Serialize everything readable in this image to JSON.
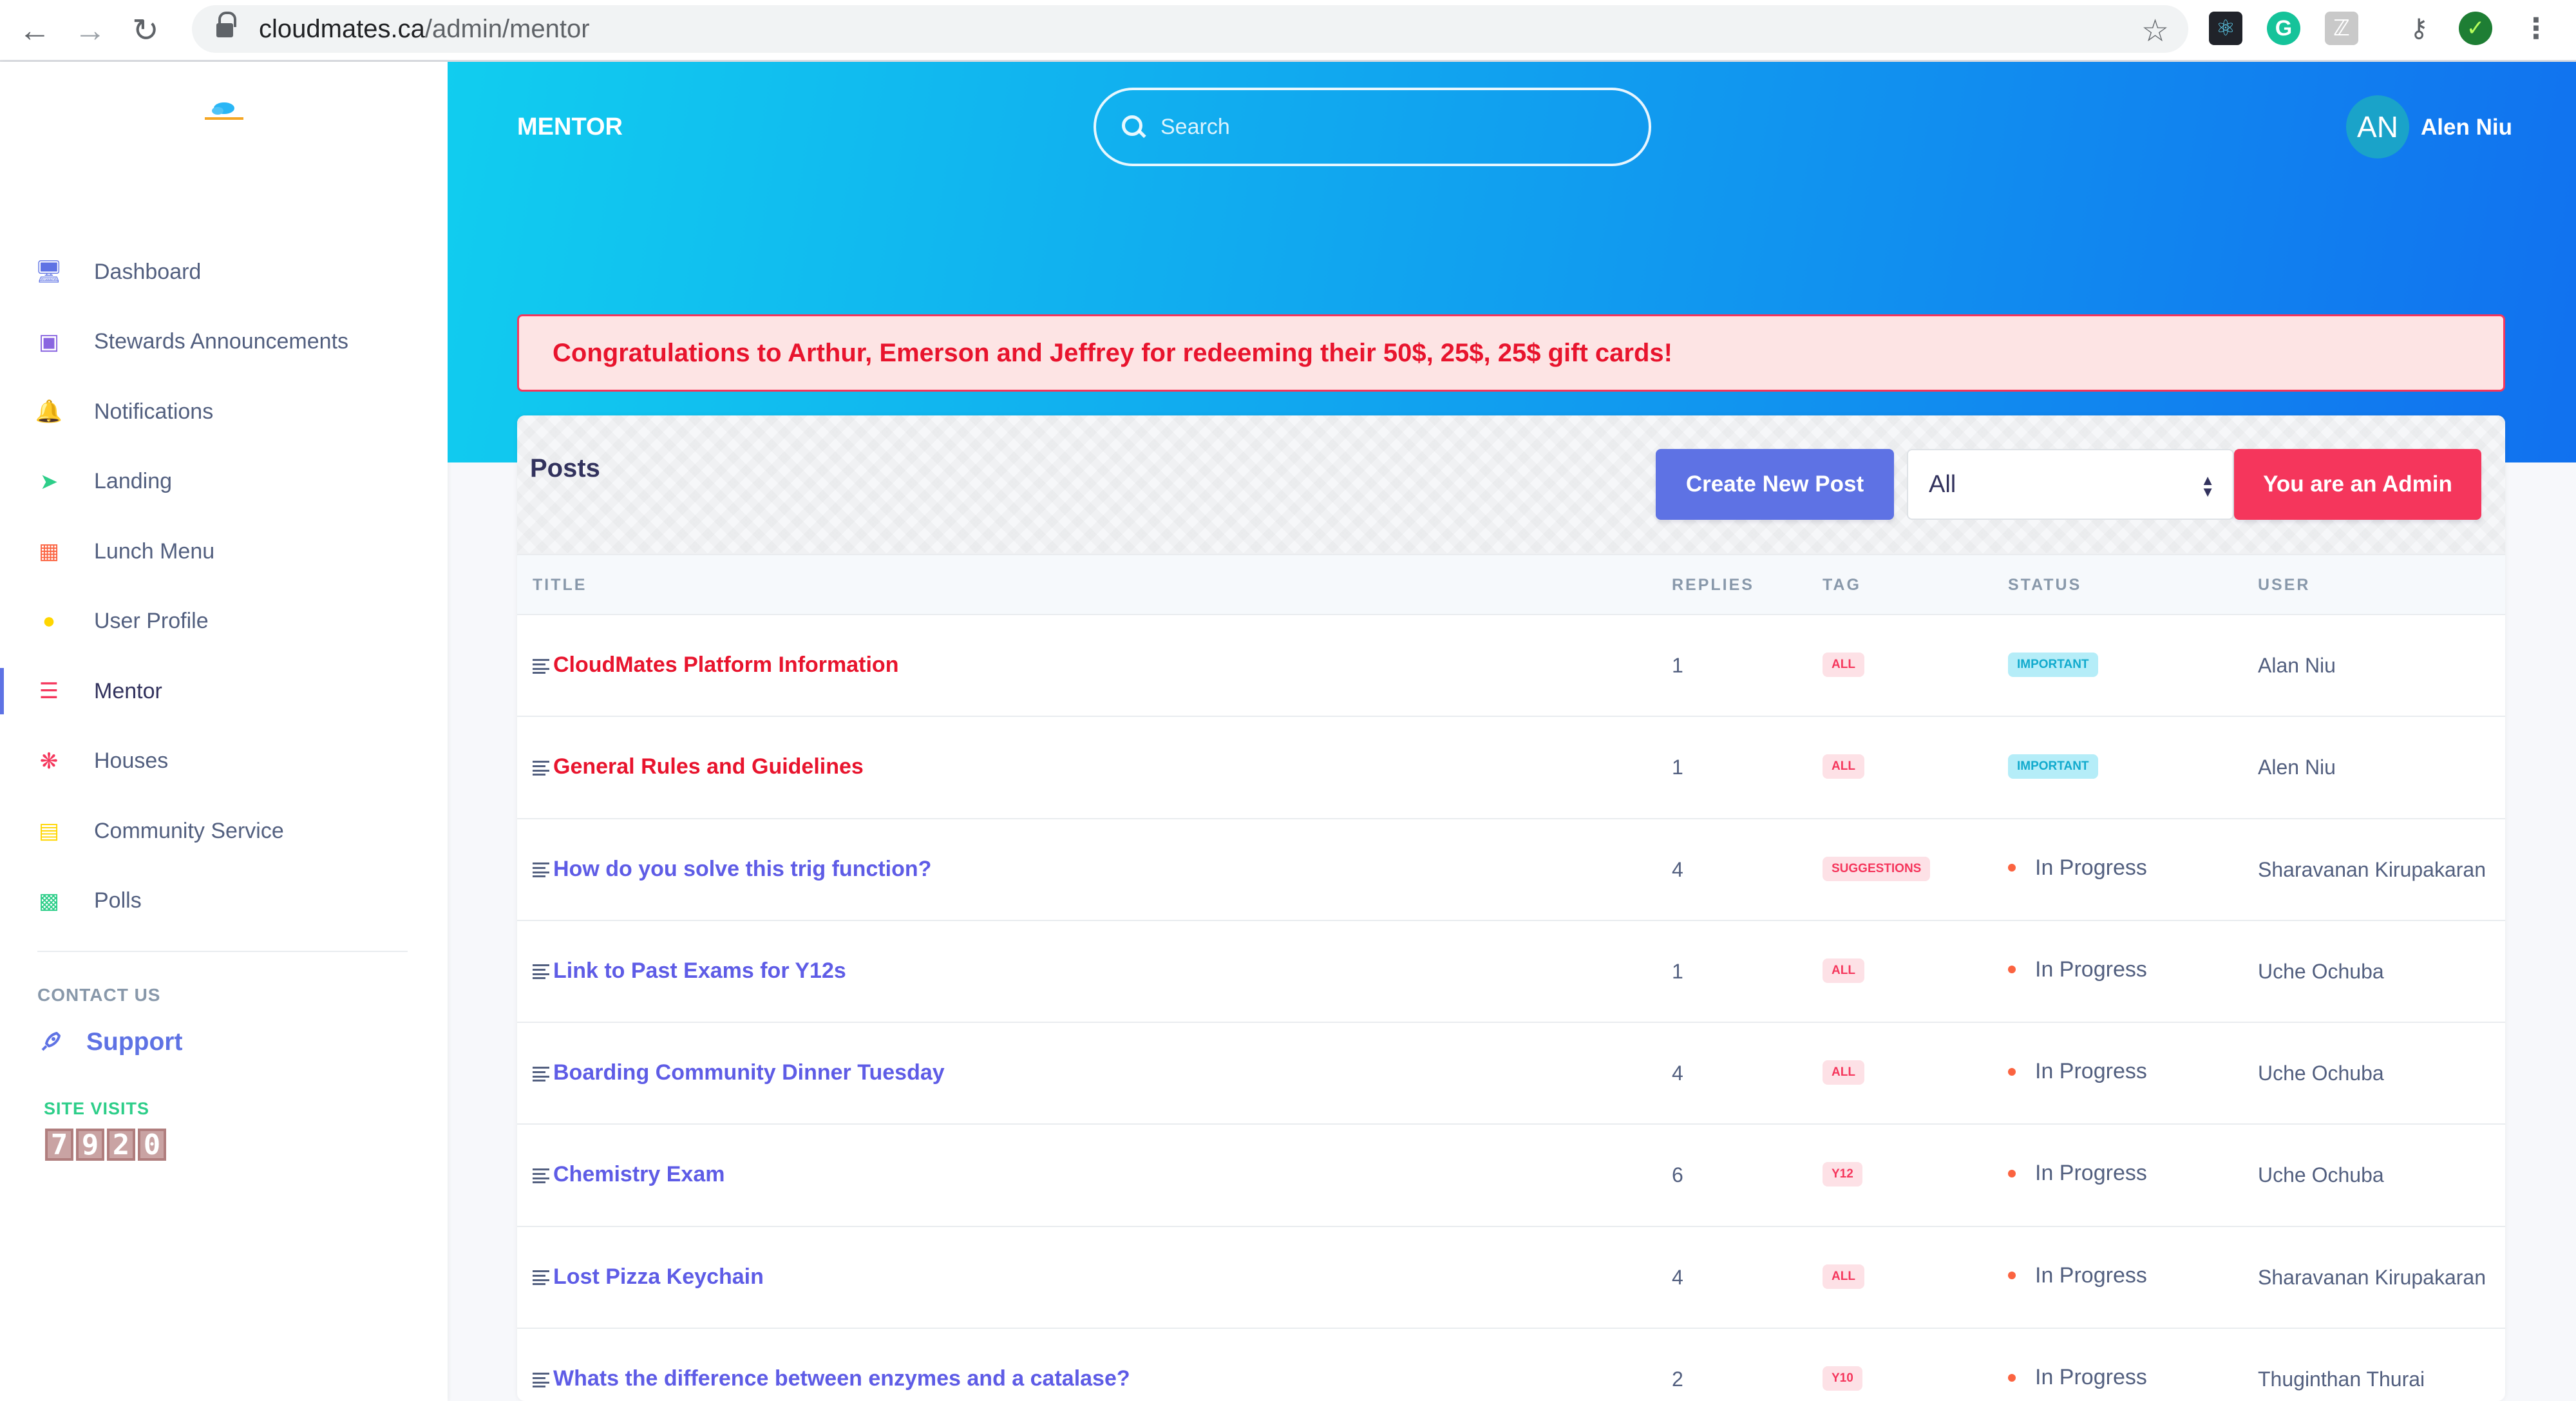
{
  "browser": {
    "url_domain": "cloudmates.ca",
    "url_path": "/admin/mentor"
  },
  "sidebar": {
    "items": [
      {
        "label": "Dashboard",
        "icon": "monitor-icon",
        "color": "#5e72e4"
      },
      {
        "label": "Stewards Announcements",
        "icon": "image-icon",
        "color": "#8965e0"
      },
      {
        "label": "Notifications",
        "icon": "bell-icon",
        "color": "#5e72e4"
      },
      {
        "label": "Landing",
        "icon": "send-icon",
        "color": "#2dce89"
      },
      {
        "label": "Lunch Menu",
        "icon": "basket-icon",
        "color": "#fb6340"
      },
      {
        "label": "User Profile",
        "icon": "user-icon",
        "color": "#ffd600"
      },
      {
        "label": "Mentor",
        "icon": "list-icon",
        "color": "#f5365c"
      },
      {
        "label": "Houses",
        "icon": "atom-icon",
        "color": "#f5365c"
      },
      {
        "label": "Community Service",
        "icon": "calendar-icon",
        "color": "#ffd600"
      },
      {
        "label": "Polls",
        "icon": "chart-bar-icon",
        "color": "#2dce89"
      }
    ],
    "active": "Mentor",
    "contact_heading": "CONTACT US",
    "support_label": "Support",
    "visits_label": "SITE VISITS",
    "visits_digits": [
      "7",
      "9",
      "2",
      "0"
    ]
  },
  "header": {
    "title": "MENTOR",
    "search_placeholder": "Search",
    "avatar_initials": "AN",
    "user_name": "Alen Niu"
  },
  "alert": {
    "text": "Congratulations to Arthur, Emerson and Jeffrey for redeeming their 50$, 25$, 25$ gift cards!"
  },
  "posts": {
    "title": "Posts",
    "create_button": "Create New Post",
    "filter_value": "All",
    "admin_button": "You are an Admin",
    "columns": [
      "TITLE",
      "REPLIES",
      "TAG",
      "STATUS",
      "USER"
    ],
    "rows": [
      {
        "title": "CloudMates Platform Information",
        "replies": "1",
        "tag": "ALL",
        "status": "IMPORTANT",
        "status_type": "badge",
        "user": "Alan Niu",
        "title_color": "#e8142d"
      },
      {
        "title": "General Rules and Guidelines",
        "replies": "1",
        "tag": "ALL",
        "status": "IMPORTANT",
        "status_type": "badge",
        "user": "Alen Niu",
        "title_color": "#e8142d"
      },
      {
        "title": "How do you solve this trig function?",
        "replies": "4",
        "tag": "SUGGESTIONS",
        "status": "In Progress",
        "status_type": "dot",
        "user": "Sharavanan Kirupakaran",
        "title_color": "#5e5ce6"
      },
      {
        "title": "Link to Past Exams for Y12s",
        "replies": "1",
        "tag": "ALL",
        "status": "In Progress",
        "status_type": "dot",
        "user": "Uche Ochuba",
        "title_color": "#5e5ce6"
      },
      {
        "title": "Boarding Community Dinner Tuesday",
        "replies": "4",
        "tag": "ALL",
        "status": "In Progress",
        "status_type": "dot",
        "user": "Uche Ochuba",
        "title_color": "#5e5ce6"
      },
      {
        "title": "Chemistry Exam",
        "replies": "6",
        "tag": "Y12",
        "status": "In Progress",
        "status_type": "dot",
        "user": "Uche Ochuba",
        "title_color": "#5e5ce6"
      },
      {
        "title": "Lost Pizza Keychain",
        "replies": "4",
        "tag": "ALL",
        "status": "In Progress",
        "status_type": "dot",
        "user": "Sharavanan Kirupakaran",
        "title_color": "#5e5ce6"
      },
      {
        "title": "Whats the difference between enzymes and a catalase?",
        "replies": "2",
        "tag": "Y10",
        "status": "In Progress",
        "status_type": "dot",
        "user": "Thuginthan Thurai",
        "title_color": "#5e5ce6"
      }
    ]
  },
  "colors": {
    "primary": "#5e72e4",
    "danger": "#f5365c",
    "gradient_start": "#11cdef",
    "gradient_end": "#1171ef"
  }
}
